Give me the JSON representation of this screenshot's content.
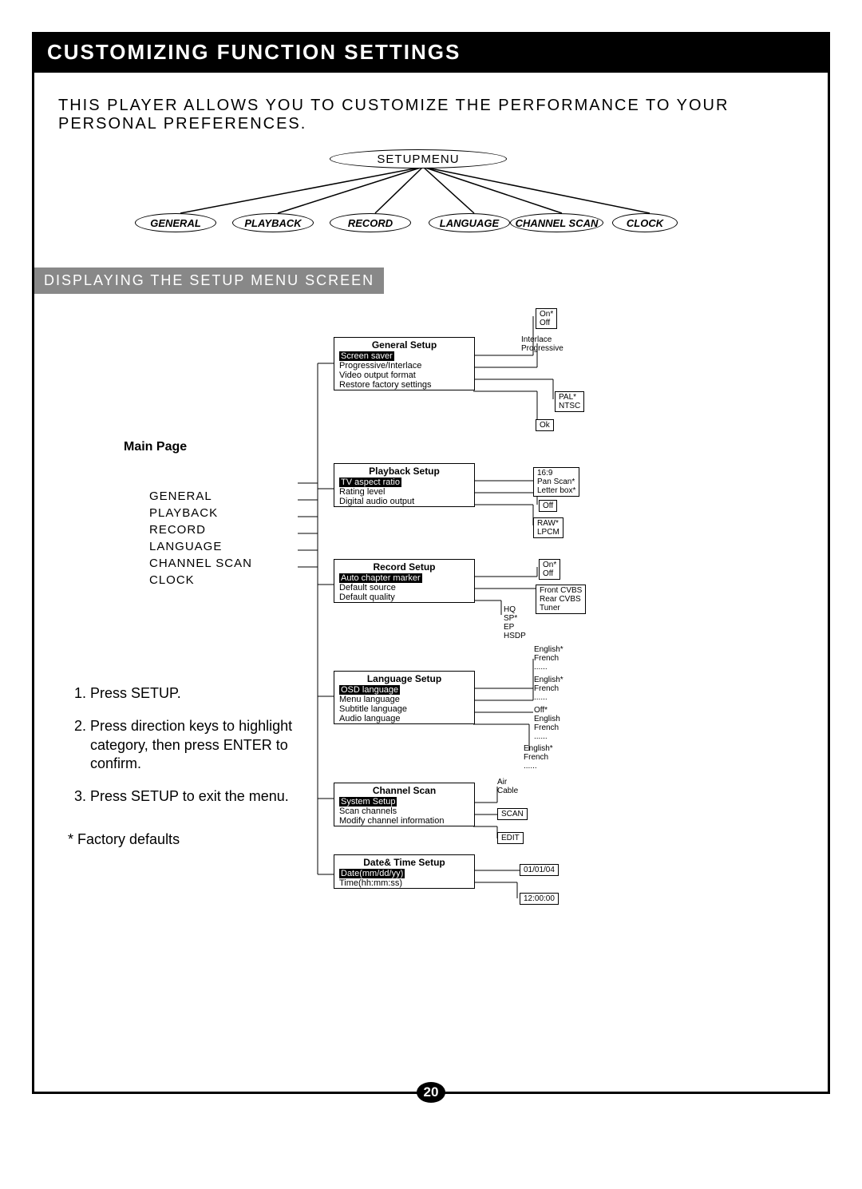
{
  "title": "CUSTOMIZING FUNCTION SETTINGS",
  "intro": "THIS PLAYER ALLOWS YOU TO CUSTOMIZE THE PERFORMANCE TO YOUR PERSONAL PREFERENCES.",
  "section_label": "DISPLAYING THE SETUP MENU SCREEN",
  "page_number": "20",
  "setup_menu_root": "SETUPMENU",
  "top_categories": {
    "general": "GENERAL",
    "playback": "PLAYBACK",
    "record": "RECORD",
    "language": "LANGUAGE",
    "channel_scan": "CHANNEL SCAN",
    "clock": "CLOCK"
  },
  "main_page_label": "Main Page",
  "main_page_items": {
    "general": "GENERAL",
    "playback": "PLAYBACK",
    "record": "RECORD",
    "language": "LANGUAGE",
    "channel_scan": "CHANNEL SCAN",
    "clock": "CLOCK"
  },
  "steps": {
    "s1": "Press SETUP.",
    "s2": "Press direction keys to highlight category, then press ENTER to confirm.",
    "s3": "Press SETUP to exit the menu."
  },
  "factory_note": "* Factory defaults",
  "general_setup": {
    "title": "General Setup",
    "screen_saver": "Screen  saver",
    "progressive_interlace": "Progressive/Interlace",
    "video_output_format": "Video output format",
    "restore": "Restore factory settings",
    "opts_screen_saver": "On*\nOff",
    "opts_prog": "Interlace\nProgressive",
    "opts_video": "PAL*\nNTSC",
    "opts_restore": "Ok"
  },
  "playback_setup": {
    "title": "Playback Setup",
    "tv_aspect": "TV aspect ratio",
    "rating": "Rating level",
    "digital_audio": "Digital audio output",
    "opts_aspect": "16:9\nPan Scan*\nLetter box*",
    "opts_rating": "Off",
    "opts_audio": "RAW*\nLPCM"
  },
  "record_setup": {
    "title": "Record Setup",
    "auto_chapter": "Auto chapter marker",
    "default_source": "Default source",
    "default_quality": "Default quality",
    "opts_chapter": "On*\nOff",
    "opts_source": "Front CVBS\nRear CVBS\nTuner",
    "opts_quality": "HQ\nSP*\nEP\nHSDP"
  },
  "language_setup": {
    "title": "Language Setup",
    "osd": "OSD language",
    "menu": "Menu language",
    "subtitle": "Subtitle  language",
    "audio": "Audio language",
    "opts_osd": "English*\nFrench\n......",
    "opts_menu": "English*\nFrench\n......",
    "opts_subtitle": "Off*\nEnglish\nFrench\n......",
    "opts_audio": "English*\nFrench\n......"
  },
  "channel_scan": {
    "title": "Channel Scan",
    "system": "System Setup",
    "scan": "Scan channels",
    "modify": "Modify channel information",
    "opts_system": "Air\nCable",
    "opts_scan": "SCAN",
    "opts_modify": "EDIT"
  },
  "datetime_setup": {
    "title": "Date& Time Setup",
    "date": "Date(mm/dd/yy)",
    "time": "Time(hh:mm:ss)",
    "opts_date": "01/01/04",
    "opts_time": "12:00:00"
  }
}
